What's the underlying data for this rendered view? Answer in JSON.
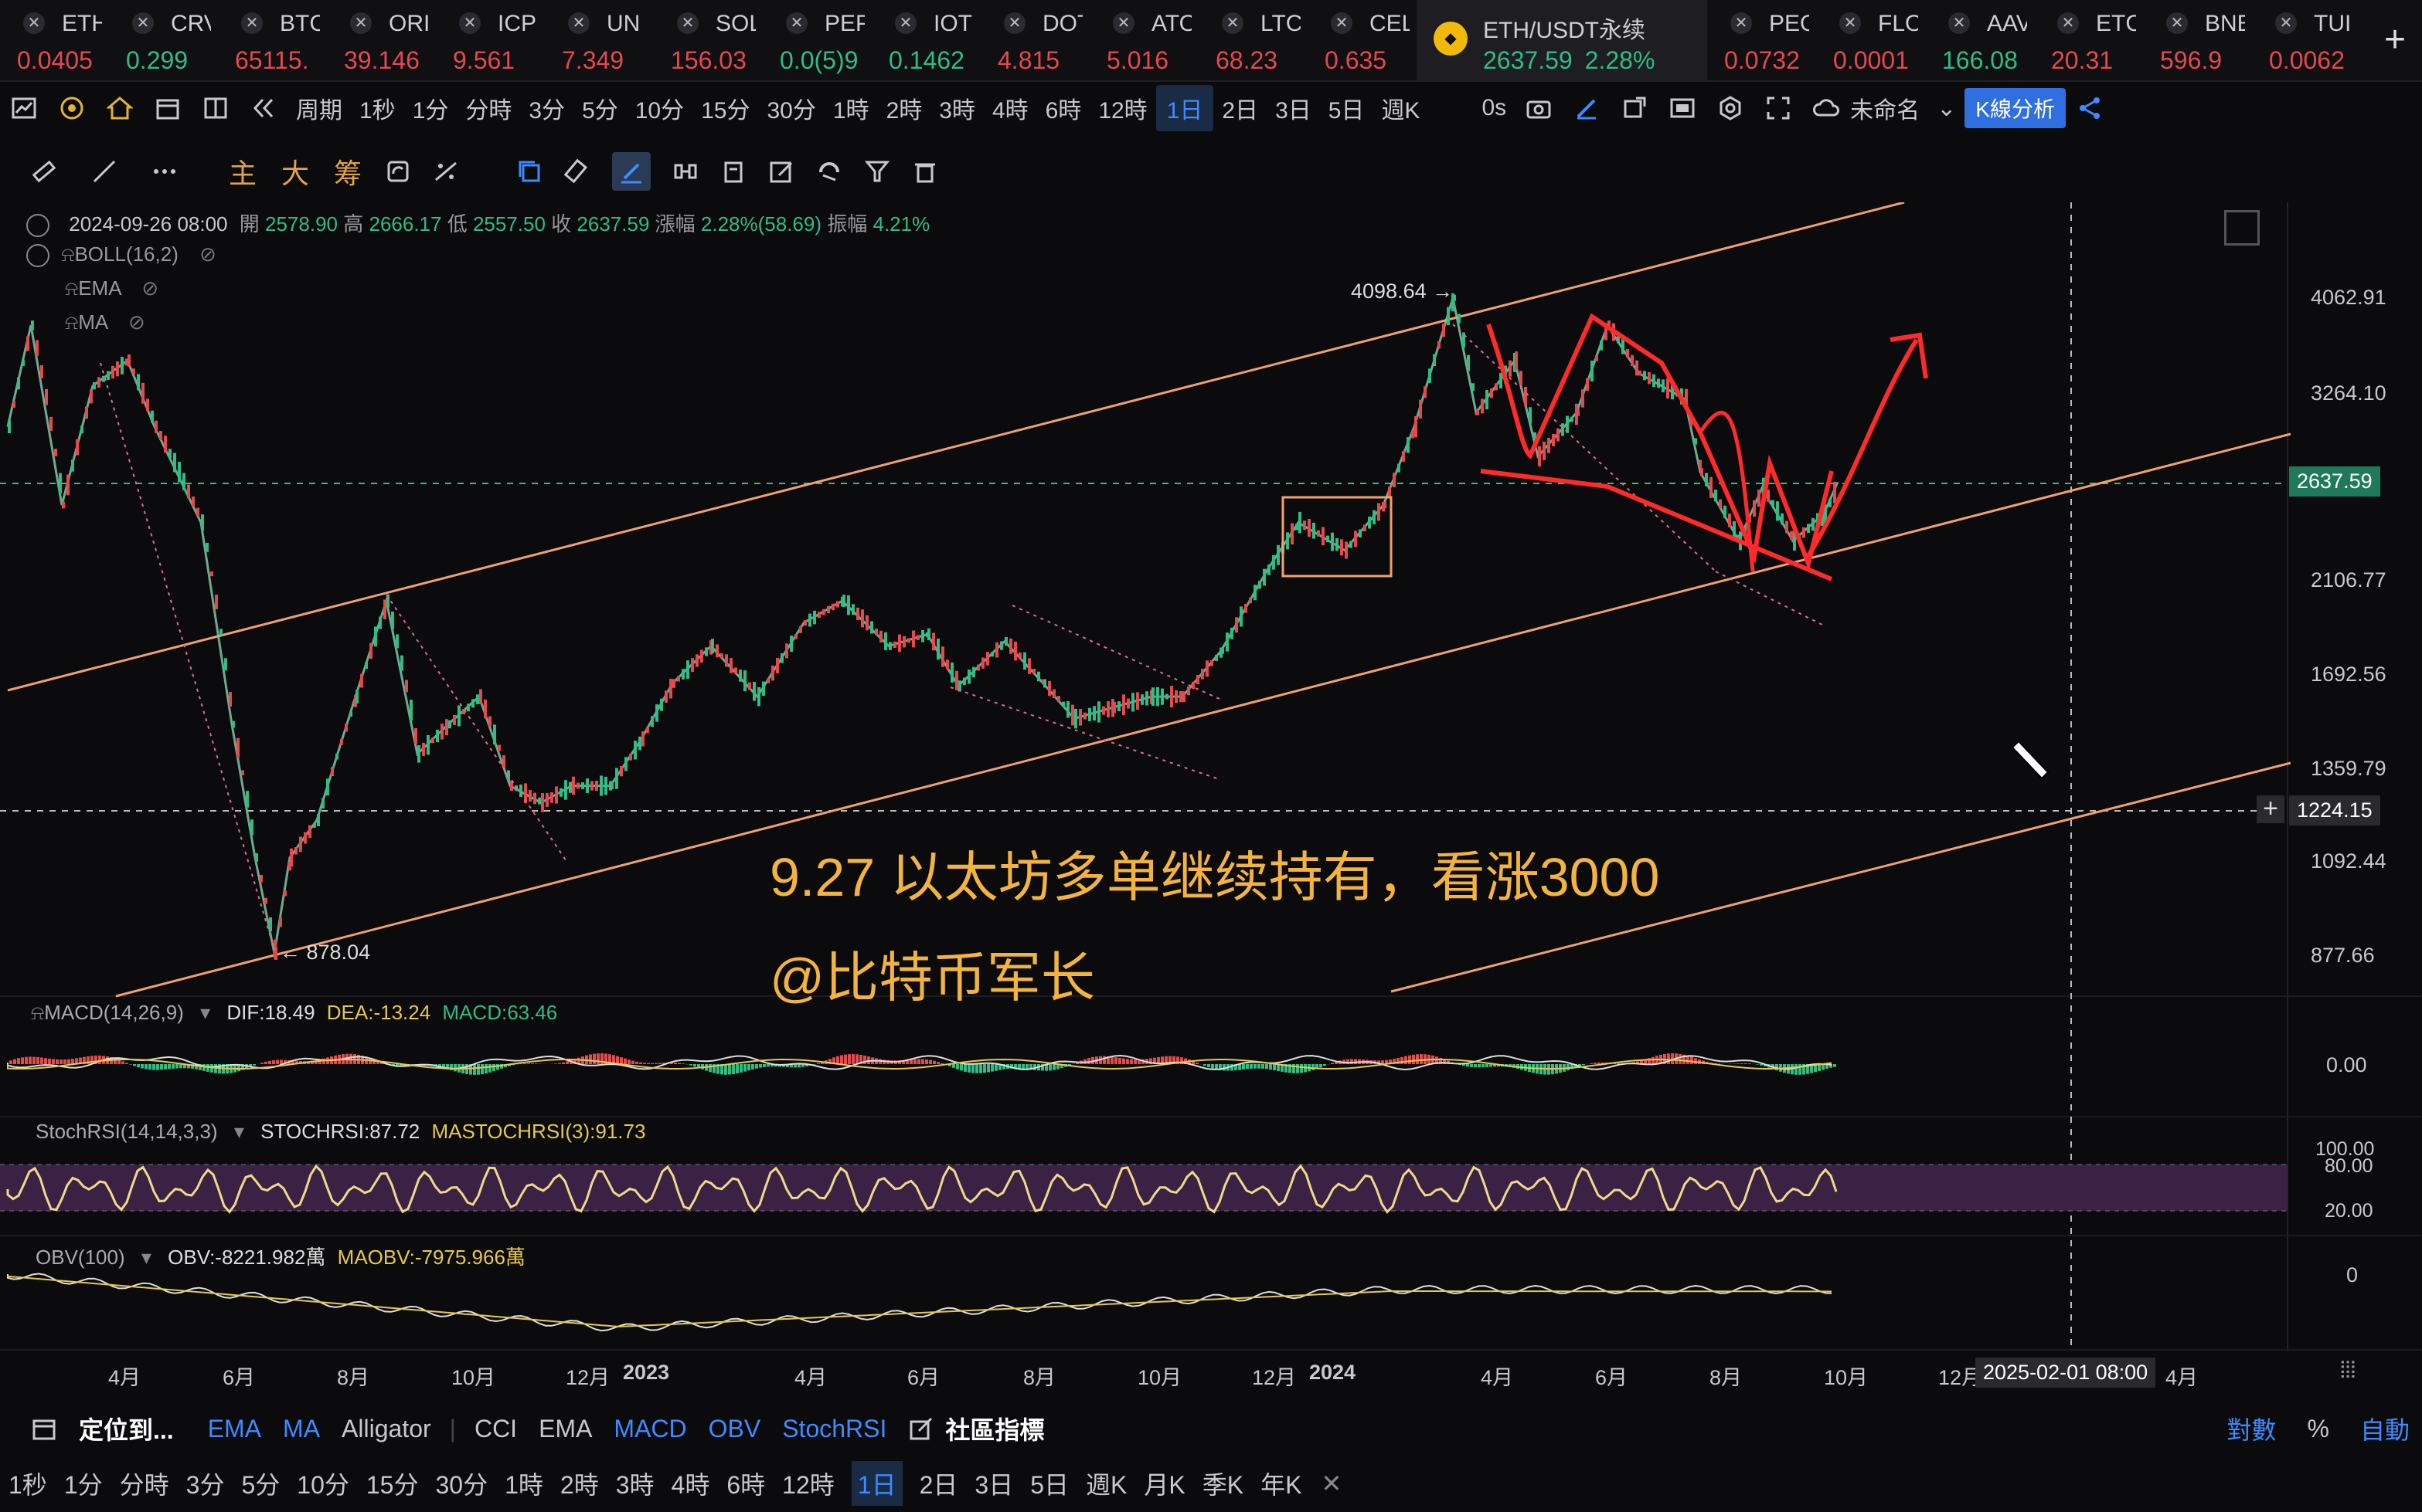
{
  "ticker": [
    {
      "name": "ETH",
      "price": "0.0405",
      "color": "#e5484d"
    },
    {
      "name": "CRV",
      "price": "0.299",
      "color": "#2ebd85"
    },
    {
      "name": "BTC",
      "price": "65115.",
      "color": "#e5484d"
    },
    {
      "name": "ORI",
      "price": "39.146",
      "color": "#e5484d"
    },
    {
      "name": "ICP",
      "price": "9.561",
      "color": "#e5484d"
    },
    {
      "name": "UN",
      "price": "7.349",
      "color": "#e5484d"
    },
    {
      "name": "SOL",
      "price": "156.03",
      "color": "#e5484d"
    },
    {
      "name": "PEP",
      "price": "0.0(5)9",
      "color": "#2ebd85"
    },
    {
      "name": "IOT",
      "price": "0.1462",
      "color": "#2ebd85"
    },
    {
      "name": "DOT",
      "price": "4.815",
      "color": "#e5484d"
    },
    {
      "name": "ATO",
      "price": "5.016",
      "color": "#e5484d"
    },
    {
      "name": "LTC",
      "price": "68.23",
      "color": "#e5484d"
    },
    {
      "name": "CEL",
      "price": "0.635",
      "color": "#e5484d"
    },
    {
      "name": "ETH/USDT永续",
      "price": "2637.59",
      "change": "2.28%",
      "color": "#2ebd85",
      "active": true
    },
    {
      "name": "PEO",
      "price": "0.0732",
      "color": "#e5484d"
    },
    {
      "name": "FLO",
      "price": "0.0001",
      "color": "#e5484d"
    },
    {
      "name": "AAV",
      "price": "166.08",
      "color": "#2ebd85"
    },
    {
      "name": "ETC",
      "price": "20.31",
      "color": "#e5484d"
    },
    {
      "name": "BNB",
      "price": "596.9",
      "color": "#e5484d"
    },
    {
      "name": "TUI",
      "price": "0.0062",
      "color": "#e5484d"
    }
  ],
  "toolbar": {
    "period_label": "周期",
    "intervals": [
      "1秒",
      "1分",
      "分時",
      "3分",
      "5分",
      "10分",
      "15分",
      "30分",
      "1時",
      "2時",
      "3時",
      "4時",
      "6時",
      "12時",
      "1日",
      "2日",
      "3日",
      "5日",
      "週K"
    ],
    "active_interval": "1日",
    "countdown": "0s",
    "layout_name": "未命名",
    "kline_btn": "K線分析"
  },
  "drawing_bar": {
    "items": [
      "主",
      "大",
      "筹"
    ]
  },
  "ohlc": {
    "date": "2024-09-26 08:00",
    "open_label": "開",
    "open": "2578.90",
    "high_label": "高",
    "high": "2666.17",
    "low_label": "低",
    "low": "2557.50",
    "close_label": "收",
    "close": "2637.59",
    "chg_label": "漲幅",
    "chg": "2.28%(58.69)",
    "amp_label": "振幅",
    "amp": "4.21%"
  },
  "indicators": {
    "boll": "BOLL(16,2)",
    "ema": "EMA",
    "ma": "MA"
  },
  "price_axis": [
    "4062.91",
    "3264.10",
    "2637.59",
    "2106.77",
    "1692.56",
    "1359.79",
    "1224.15",
    "1092.44",
    "877.66"
  ],
  "last_price_tag": "2637.59",
  "cursor_price_tag": "1224.15",
  "annotations": {
    "high": "4098.64",
    "low": "878.04",
    "text1": "9.27 以太坊多单继续持有，看涨3000",
    "text2": "@比特币军长"
  },
  "macd": {
    "label": "MACD(14,26,9)",
    "dif": "DIF:18.49",
    "dea": "DEA:-13.24",
    "macd": "MACD:63.46",
    "axis": "0.00"
  },
  "stochrsi": {
    "label": "StochRSI(14,14,3,3)",
    "k": "STOCHRSI:87.72",
    "d": "MASTOCHRSI(3):91.73",
    "axis": [
      "100.00",
      "80.00",
      "20.00"
    ]
  },
  "obv": {
    "label": "OBV(100)",
    "obv": "OBV:-8221.982萬",
    "ma": "MAOBV:-7975.966萬",
    "axis": "0"
  },
  "time_axis": [
    "4月",
    "6月",
    "8月",
    "10月",
    "12月",
    "2023",
    "4月",
    "6月",
    "8月",
    "10月",
    "12月",
    "2024",
    "4月",
    "6月",
    "8月",
    "10月",
    "12月",
    "4月"
  ],
  "crosshair_time": "2025-02-01 08:00",
  "bottom_bar1": {
    "locate": "定位到...",
    "main_ind": [
      "EMA",
      "MA",
      "Alligator"
    ],
    "sub_ind": [
      "CCI",
      "EMA",
      "MACD",
      "OBV",
      "StochRSI"
    ],
    "community": "社區指標",
    "right": [
      "對數",
      "%",
      "自動"
    ]
  },
  "bottom_bar2": [
    "1秒",
    "1分",
    "分時",
    "3分",
    "5分",
    "10分",
    "15分",
    "30分",
    "1時",
    "2時",
    "3時",
    "4時",
    "6時",
    "12時",
    "1日",
    "2日",
    "3日",
    "5日",
    "週K",
    "月K",
    "季K",
    "年K"
  ],
  "bottom_active": "1日",
  "colors": {
    "up": "#2ebd85",
    "down": "#e5484d",
    "accent": "#3d8bff",
    "channel": "#f0a070",
    "annot": "#f2b43e"
  }
}
